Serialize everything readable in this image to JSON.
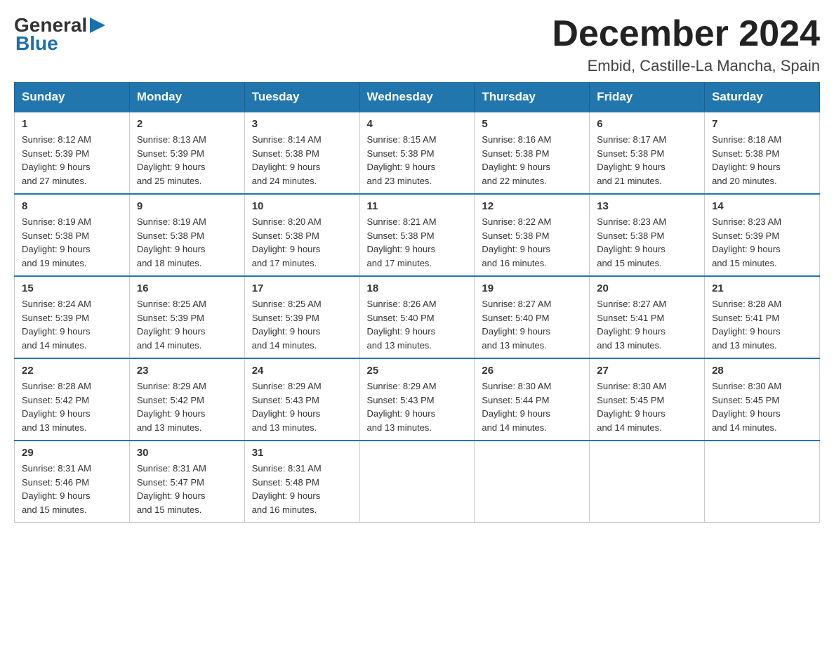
{
  "header": {
    "logo_line1": "General",
    "logo_line2": "Blue",
    "month_title": "December 2024",
    "location": "Embid, Castille-La Mancha, Spain"
  },
  "days_of_week": [
    "Sunday",
    "Monday",
    "Tuesday",
    "Wednesday",
    "Thursday",
    "Friday",
    "Saturday"
  ],
  "weeks": [
    [
      {
        "day": "1",
        "sunrise": "8:12 AM",
        "sunset": "5:39 PM",
        "daylight": "9 hours and 27 minutes."
      },
      {
        "day": "2",
        "sunrise": "8:13 AM",
        "sunset": "5:39 PM",
        "daylight": "9 hours and 25 minutes."
      },
      {
        "day": "3",
        "sunrise": "8:14 AM",
        "sunset": "5:38 PM",
        "daylight": "9 hours and 24 minutes."
      },
      {
        "day": "4",
        "sunrise": "8:15 AM",
        "sunset": "5:38 PM",
        "daylight": "9 hours and 23 minutes."
      },
      {
        "day": "5",
        "sunrise": "8:16 AM",
        "sunset": "5:38 PM",
        "daylight": "9 hours and 22 minutes."
      },
      {
        "day": "6",
        "sunrise": "8:17 AM",
        "sunset": "5:38 PM",
        "daylight": "9 hours and 21 minutes."
      },
      {
        "day": "7",
        "sunrise": "8:18 AM",
        "sunset": "5:38 PM",
        "daylight": "9 hours and 20 minutes."
      }
    ],
    [
      {
        "day": "8",
        "sunrise": "8:19 AM",
        "sunset": "5:38 PM",
        "daylight": "9 hours and 19 minutes."
      },
      {
        "day": "9",
        "sunrise": "8:19 AM",
        "sunset": "5:38 PM",
        "daylight": "9 hours and 18 minutes."
      },
      {
        "day": "10",
        "sunrise": "8:20 AM",
        "sunset": "5:38 PM",
        "daylight": "9 hours and 17 minutes."
      },
      {
        "day": "11",
        "sunrise": "8:21 AM",
        "sunset": "5:38 PM",
        "daylight": "9 hours and 17 minutes."
      },
      {
        "day": "12",
        "sunrise": "8:22 AM",
        "sunset": "5:38 PM",
        "daylight": "9 hours and 16 minutes."
      },
      {
        "day": "13",
        "sunrise": "8:23 AM",
        "sunset": "5:38 PM",
        "daylight": "9 hours and 15 minutes."
      },
      {
        "day": "14",
        "sunrise": "8:23 AM",
        "sunset": "5:39 PM",
        "daylight": "9 hours and 15 minutes."
      }
    ],
    [
      {
        "day": "15",
        "sunrise": "8:24 AM",
        "sunset": "5:39 PM",
        "daylight": "9 hours and 14 minutes."
      },
      {
        "day": "16",
        "sunrise": "8:25 AM",
        "sunset": "5:39 PM",
        "daylight": "9 hours and 14 minutes."
      },
      {
        "day": "17",
        "sunrise": "8:25 AM",
        "sunset": "5:39 PM",
        "daylight": "9 hours and 14 minutes."
      },
      {
        "day": "18",
        "sunrise": "8:26 AM",
        "sunset": "5:40 PM",
        "daylight": "9 hours and 13 minutes."
      },
      {
        "day": "19",
        "sunrise": "8:27 AM",
        "sunset": "5:40 PM",
        "daylight": "9 hours and 13 minutes."
      },
      {
        "day": "20",
        "sunrise": "8:27 AM",
        "sunset": "5:41 PM",
        "daylight": "9 hours and 13 minutes."
      },
      {
        "day": "21",
        "sunrise": "8:28 AM",
        "sunset": "5:41 PM",
        "daylight": "9 hours and 13 minutes."
      }
    ],
    [
      {
        "day": "22",
        "sunrise": "8:28 AM",
        "sunset": "5:42 PM",
        "daylight": "9 hours and 13 minutes."
      },
      {
        "day": "23",
        "sunrise": "8:29 AM",
        "sunset": "5:42 PM",
        "daylight": "9 hours and 13 minutes."
      },
      {
        "day": "24",
        "sunrise": "8:29 AM",
        "sunset": "5:43 PM",
        "daylight": "9 hours and 13 minutes."
      },
      {
        "day": "25",
        "sunrise": "8:29 AM",
        "sunset": "5:43 PM",
        "daylight": "9 hours and 13 minutes."
      },
      {
        "day": "26",
        "sunrise": "8:30 AM",
        "sunset": "5:44 PM",
        "daylight": "9 hours and 14 minutes."
      },
      {
        "day": "27",
        "sunrise": "8:30 AM",
        "sunset": "5:45 PM",
        "daylight": "9 hours and 14 minutes."
      },
      {
        "day": "28",
        "sunrise": "8:30 AM",
        "sunset": "5:45 PM",
        "daylight": "9 hours and 14 minutes."
      }
    ],
    [
      {
        "day": "29",
        "sunrise": "8:31 AM",
        "sunset": "5:46 PM",
        "daylight": "9 hours and 15 minutes."
      },
      {
        "day": "30",
        "sunrise": "8:31 AM",
        "sunset": "5:47 PM",
        "daylight": "9 hours and 15 minutes."
      },
      {
        "day": "31",
        "sunrise": "8:31 AM",
        "sunset": "5:48 PM",
        "daylight": "9 hours and 16 minutes."
      },
      null,
      null,
      null,
      null
    ]
  ],
  "labels": {
    "sunrise": "Sunrise:",
    "sunset": "Sunset:",
    "daylight": "Daylight:"
  }
}
